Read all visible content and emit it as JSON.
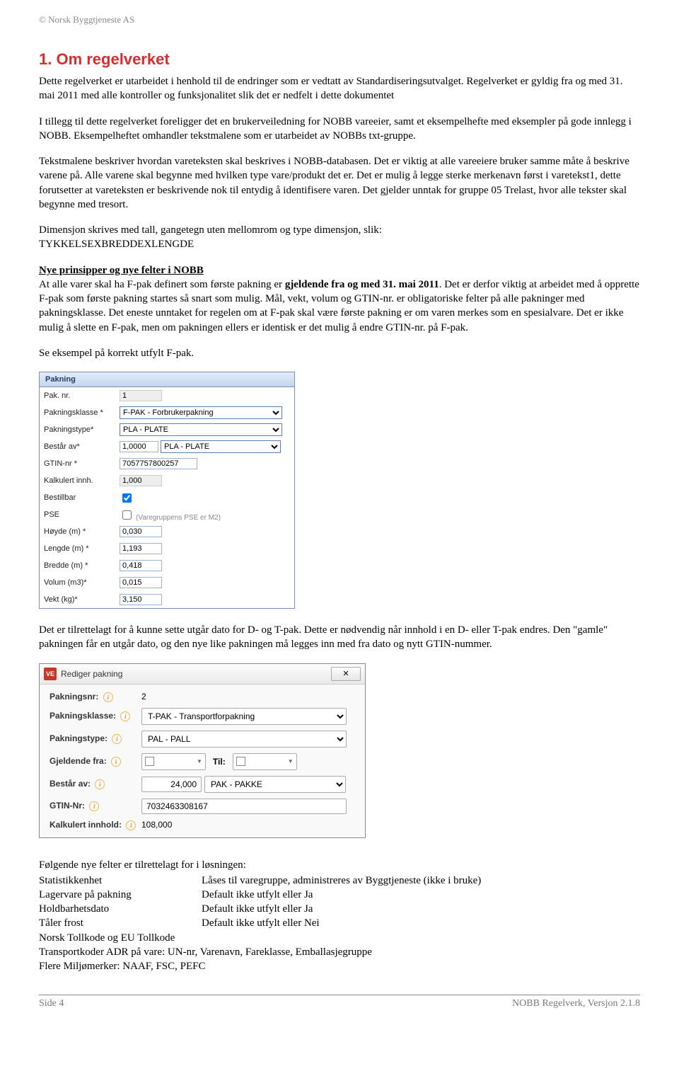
{
  "header": {
    "copyright": "© Norsk Byggtjeneste AS"
  },
  "heading": "1.   Om regelverket",
  "p1": "Dette regelverket er utarbeidet i henhold til de endringer som er vedtatt av Standardiseringsutvalget. Regelverket er gyldig fra og med 31. mai 2011 med alle kontroller og funksjonalitet slik det er nedfelt i dette dokumentet",
  "p2": "I tillegg til dette regelverket foreligger det en brukerveiledning for NOBB vareeier, samt et eksempelhefte med eksempler på gode innlegg i NOBB. Eksempelheftet omhandler tekstmalene som er utarbeidet av NOBBs txt-gruppe.",
  "p3": "Tekstmalene beskriver hvordan vareteksten skal beskrives i NOBB-databasen. Det er viktig at alle vareeiere bruker samme måte å beskrive varene på. Alle varene skal begynne med hvilken type vare/produkt det er. Det er mulig å legge sterke merkenavn først i varetekst1, dette forutsetter at vareteksten er beskrivende nok til entydig å identifisere varen. Det gjelder unntak for gruppe 05 Trelast, hvor alle tekster skal begynne med tresort.",
  "p4a": "Dimensjon skrives med tall, gangetegn uten mellomrom og type dimensjon, slik:",
  "p4b": "TYKKELSEXBREDDEXLENGDE",
  "sub_heading": "Nye prinsipper og nye felter i NOBB",
  "p5a": "At alle varer skal ha F-pak definert som første pakning er ",
  "p5b": "gjeldende fra og med 31. mai 2011",
  "p5c": ". Det er derfor viktig at arbeidet med å opprette F-pak som første pakning startes så snart som mulig. Mål, vekt, volum og GTIN-nr. er obligatoriske felter på alle pakninger med pakningsklasse. Det eneste unntaket for regelen om at F-pak skal være første pakning er om varen merkes som en spesialvare. Det er ikke mulig å slette en F-pak, men om pakningen ellers er identisk er det mulig å endre GTIN-nr. på F-pak.",
  "p6": "Se eksempel på korrekt utfylt F-pak.",
  "form1": {
    "title": "Pakning",
    "labels": {
      "paknr": "Pak. nr.",
      "pakklasse": "Pakningsklasse *",
      "paktype": "Pakningstype*",
      "bestar": "Består av*",
      "gtin": "GTIN-nr *",
      "kalk": "Kalkulert innh.",
      "bestillbar": "Bestillbar",
      "pse": "PSE",
      "pse_note": "(Varegruppens PSE er M2)",
      "hoyde": "Høyde (m) *",
      "lengde": "Lengde (m) *",
      "bredde": "Bredde (m) *",
      "volum": "Volum (m3)*",
      "vekt": "Vekt (kg)*"
    },
    "values": {
      "paknr": "1",
      "pakklasse": "F-PAK - Forbrukerpakning",
      "paktype": "PLA - PLATE",
      "bestar_qty": "1,0000",
      "bestar_unit": "PLA - PLATE",
      "gtin": "7057757800257",
      "kalk": "1,000",
      "hoyde": "0,030",
      "lengde": "1,193",
      "bredde": "0,418",
      "volum": "0,015",
      "vekt": "3,150"
    }
  },
  "p7": "Det er tilrettelagt for å kunne sette utgår dato for D- og T-pak. Dette er nødvendig når innhold i en D- eller T-pak endres. Den \"gamle\" pakningen får en utgår dato, og den nye like pakningen må legges inn med fra dato og nytt GTIN-nummer.",
  "dialog": {
    "title": "Rediger pakning",
    "labels": {
      "paknr": "Pakningsnr:",
      "pakklasse": "Pakningsklasse:",
      "paktype": "Pakningstype:",
      "gjeldende": "Gjeldende fra:",
      "til": "Til:",
      "bestar": "Består av:",
      "gtin": "GTIN-Nr:",
      "kalk": "Kalkulert innhold:"
    },
    "values": {
      "paknr": "2",
      "pakklasse": "T-PAK - Transportforpakning",
      "paktype": "PAL - PALL",
      "bestar_qty": "24,000",
      "bestar_unit": "PAK - PAKKE",
      "gtin": "7032463308167",
      "kalk": "108,000"
    }
  },
  "p8": "Følgende nye felter er tilrettelagt for i løsningen:",
  "fields": [
    {
      "name": "Statistikkenhet",
      "desc": "Låses til varegruppe, administreres av Byggtjeneste (ikke i bruke)"
    },
    {
      "name": "Lagervare på pakning",
      "desc": "Default ikke utfylt eller Ja"
    },
    {
      "name": "Holdbarhetsdato",
      "desc": "Default ikke utfylt eller Ja"
    },
    {
      "name": "Tåler frost",
      "desc": "Default ikke utfylt eller Nei"
    },
    {
      "name": "Norsk Tollkode og EU Tollkode",
      "desc": ""
    },
    {
      "name": "Transportkoder ADR på vare: UN-nr, Varenavn, Fareklasse, Emballasjegruppe",
      "desc": ""
    },
    {
      "name": "Flere Miljømerker: NAAF, FSC, PEFC",
      "desc": ""
    }
  ],
  "footer": {
    "left": "Side 4",
    "right": "NOBB Regelverk, Versjon 2.1.8"
  }
}
